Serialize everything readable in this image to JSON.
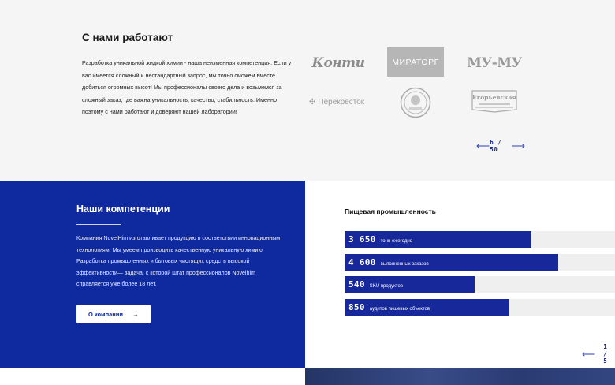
{
  "partners": {
    "title": "С нами работают",
    "text": "Разработка уникальной жидкой химии - наша неизменная компетенция. Если у вас имеется сложный и нестандартный запрос, мы точно сможем вместе добиться огромных высот! Мы профессионалы своего дела и возьмемся за сложный заказ, где важна уникальность, качество, стабильность. Именно поэтому с нами работают и доверяют нашей лаборатории!",
    "logos": {
      "konti": "Конти",
      "miratorg": "МИРАТОРГ",
      "mumu": "МУ-МУ",
      "perekrestok": "Перекрёсток",
      "perekrestok_icon": "perekrestok-cross-icon",
      "seal_icon": "round-seal-logo-icon",
      "yegorievskaya": "Егорьевская"
    },
    "slider": {
      "prev_icon": "arrow-left-icon",
      "next_icon": "arrow-right-icon",
      "counter": "6 / 50"
    }
  },
  "competence": {
    "title": "Наши компетенции",
    "text": "Компания NovelHim изготавливает продукцию в соответствии инновационным технологиям. Мы умеем производить качественную уникальную химию. Разработка промышленных и бытовых чистящих средств высокой эффективности— задача, с которой штат профессионалов Novelhim справляется уже более 18 лет.",
    "button_label": "О компании",
    "button_icon": "arrow-right-icon"
  },
  "stats": {
    "title": "Пищевая промышленность",
    "items": [
      {
        "value": "3 650",
        "caption": "тонн ежегодно",
        "fill_fraction": 0.69
      },
      {
        "value": "4 600",
        "caption": "выполненных заказов",
        "fill_fraction": 0.79
      },
      {
        "value": "540",
        "caption": "SKU продуктов",
        "fill_fraction": 0.48
      },
      {
        "value": "850",
        "caption": "аудитов пищевых объектов",
        "fill_fraction": 0.61
      }
    ],
    "slider": {
      "prev_icon": "arrow-left-icon",
      "counter": "1 / 5"
    }
  },
  "colors": {
    "brand_blue": "#0f2a9e",
    "bar_blue": "#16289a",
    "bar_track": "#efefef",
    "section_gray": "#f5f5f5"
  }
}
